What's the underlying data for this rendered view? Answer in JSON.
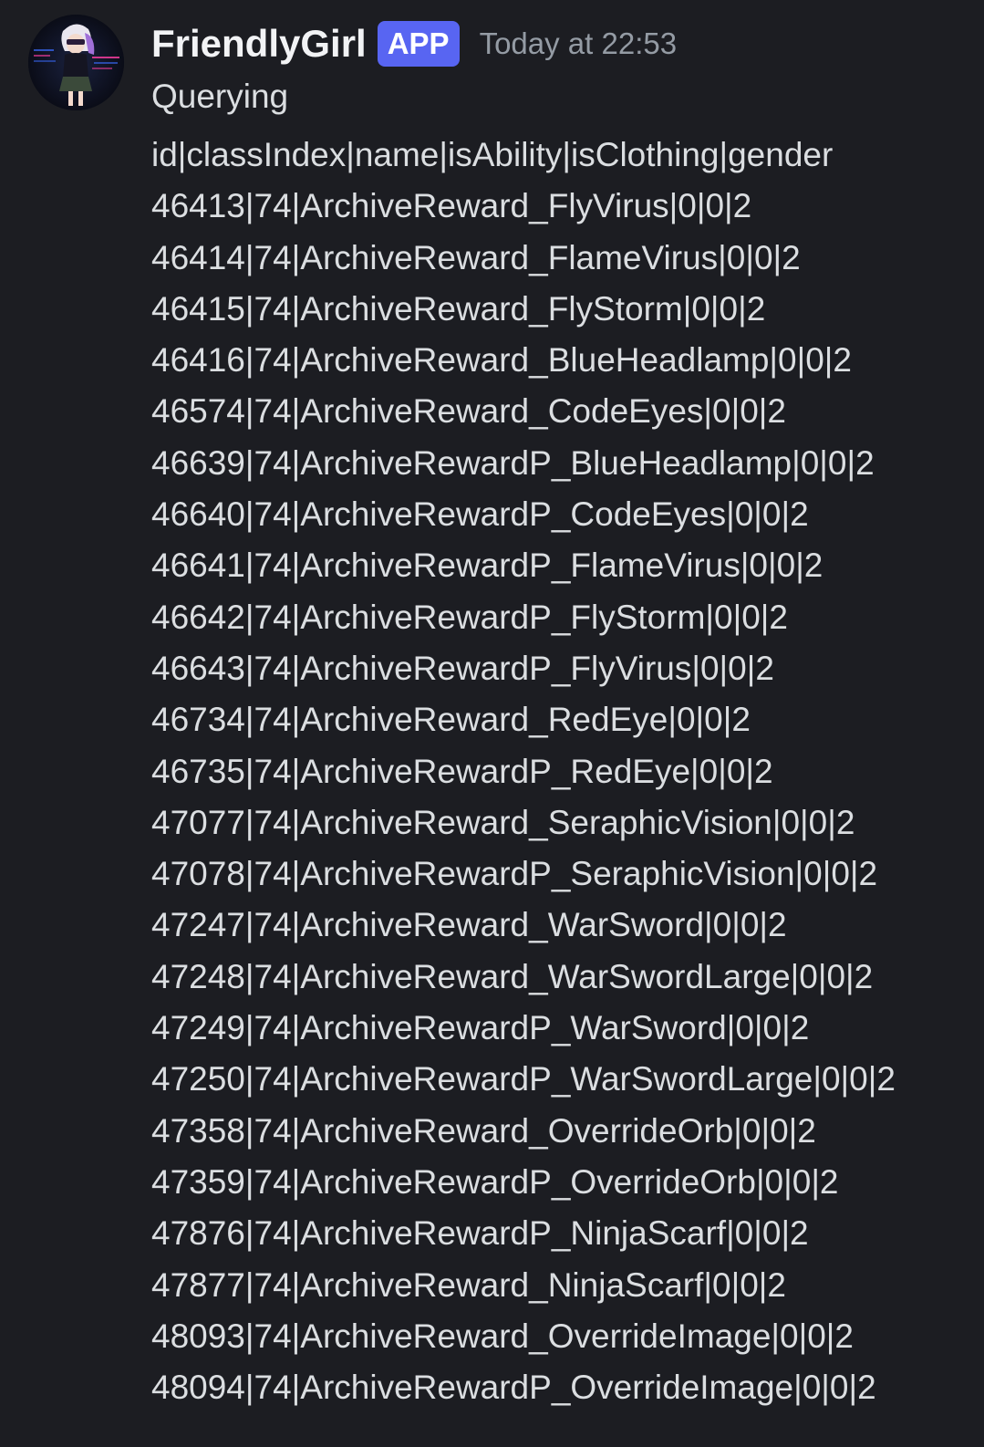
{
  "message": {
    "author": "FriendlyGirl",
    "badge": "APP",
    "timestamp": "Today at 22:53",
    "status_text": "Querying",
    "lines": [
      "id|classIndex|name|isAbility|isClothing|gender",
      "46413|74|ArchiveReward_FlyVirus|0|0|2",
      "46414|74|ArchiveReward_FlameVirus|0|0|2",
      "46415|74|ArchiveReward_FlyStorm|0|0|2",
      "46416|74|ArchiveReward_BlueHeadlamp|0|0|2",
      "46574|74|ArchiveReward_CodeEyes|0|0|2",
      "46639|74|ArchiveRewardP_BlueHeadlamp|0|0|2",
      "46640|74|ArchiveRewardP_CodeEyes|0|0|2",
      "46641|74|ArchiveRewardP_FlameVirus|0|0|2",
      "46642|74|ArchiveRewardP_FlyStorm|0|0|2",
      "46643|74|ArchiveRewardP_FlyVirus|0|0|2",
      "46734|74|ArchiveReward_RedEye|0|0|2",
      "46735|74|ArchiveRewardP_RedEye|0|0|2",
      "47077|74|ArchiveReward_SeraphicVision|0|0|2",
      "47078|74|ArchiveRewardP_SeraphicVision|0|0|2",
      "47247|74|ArchiveReward_WarSword|0|0|2",
      "47248|74|ArchiveReward_WarSwordLarge|0|0|2",
      "47249|74|ArchiveRewardP_WarSword|0|0|2",
      "47250|74|ArchiveRewardP_WarSwordLarge|0|0|2",
      "47358|74|ArchiveReward_OverrideOrb|0|0|2",
      "47359|74|ArchiveRewardP_OverrideOrb|0|0|2",
      "47876|74|ArchiveRewardP_NinjaScarf|0|0|2",
      "47877|74|ArchiveReward_NinjaScarf|0|0|2",
      "48093|74|ArchiveReward_OverrideImage|0|0|2",
      "48094|74|ArchiveRewardP_OverrideImage|0|0|2"
    ]
  },
  "theme": {
    "background": "#1c1d22",
    "text": "#dbdee1",
    "username": "#f2f3f5",
    "badge_bg": "#5865f2",
    "timestamp": "#949ba4"
  },
  "icons": {
    "avatar": "avatar-image"
  }
}
